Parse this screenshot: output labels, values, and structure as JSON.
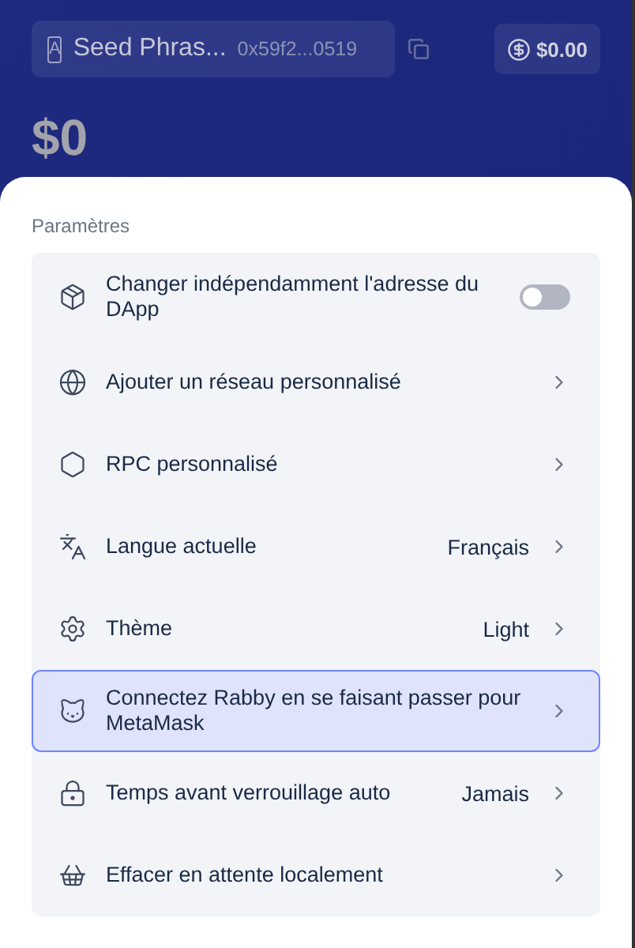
{
  "header": {
    "account_badge": "A",
    "account_name": "Seed Phras...",
    "address": "0x59f2...0519",
    "balance_button": "$0.00",
    "total": "$0"
  },
  "settings": {
    "title": "Paramètres",
    "items": [
      {
        "kind": "toggle",
        "label": "Changer indépendamment l'adresse du DApp",
        "on": false,
        "selected": false
      },
      {
        "kind": "link",
        "label": "Ajouter un réseau personnalisé",
        "selected": false
      },
      {
        "kind": "link",
        "label": "RPC personnalisé",
        "selected": false
      },
      {
        "kind": "link",
        "label": "Langue actuelle",
        "value": "Français",
        "selected": false
      },
      {
        "kind": "link",
        "label": "Thème",
        "value": "Light",
        "selected": false
      },
      {
        "kind": "link",
        "label": "Connectez Rabby en se faisant passer pour MetaMask",
        "selected": true
      },
      {
        "kind": "link",
        "label": "Temps avant verrouillage auto",
        "value": "Jamais",
        "selected": false
      },
      {
        "kind": "link",
        "label": "Effacer en attente localement",
        "selected": false
      }
    ]
  }
}
